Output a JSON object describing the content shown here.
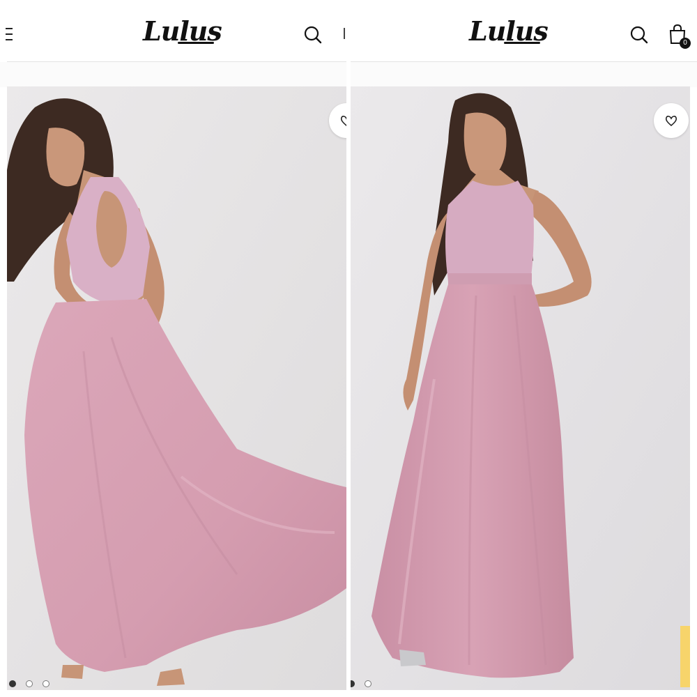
{
  "brand": {
    "logo_text": "Lulus"
  },
  "panels": [
    {
      "header": {
        "menu_icon": "hamburger-icon",
        "search_icon": "search-icon"
      },
      "product_image": {
        "dress_color": "#d9a3b6",
        "background": "#e9e7e8"
      },
      "carousel": {
        "total": 3,
        "active_index": 0
      }
    },
    {
      "header": {
        "search_icon": "search-icon",
        "cart_icon": "shopping-bag-icon",
        "cart_count": "0"
      },
      "product_image": {
        "dress_color": "#d59fb3",
        "background": "#e8e7e9"
      },
      "carousel": {
        "total": 2,
        "active_index": 0
      }
    }
  ],
  "colors": {
    "dress": "#d8a2b5",
    "lace": "#d9b0c6",
    "hair": "#3d2a22",
    "skin": "#c9977a",
    "accent_tab": "#f7d46b"
  }
}
